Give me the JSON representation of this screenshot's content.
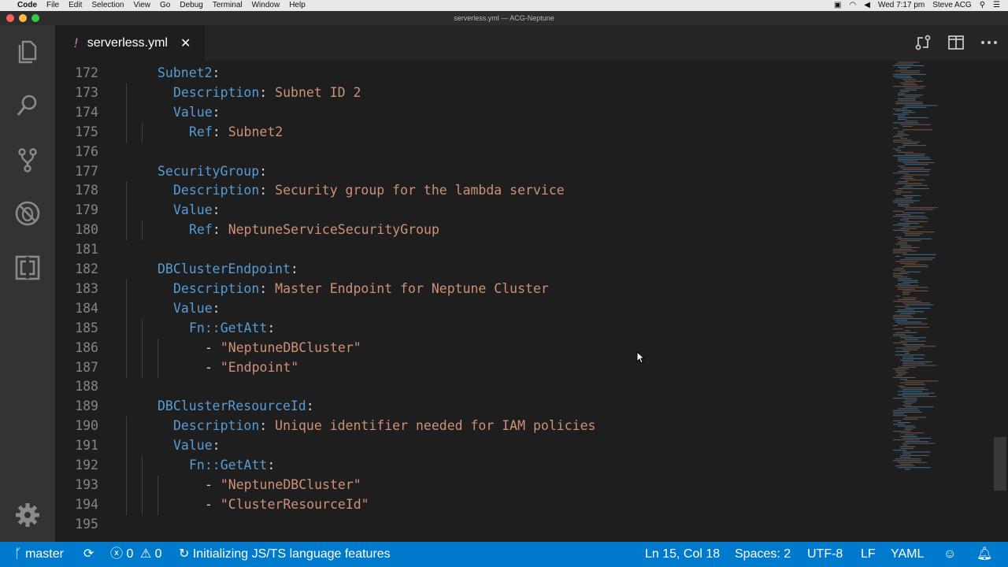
{
  "menubar": {
    "app_name": "Code",
    "items": [
      "File",
      "Edit",
      "Selection",
      "View",
      "Go",
      "Debug",
      "Terminal",
      "Window",
      "Help"
    ],
    "clock": "Wed 7:17 pm",
    "user": "Steve ACG"
  },
  "window": {
    "title": "serverless.yml — ACG-Neptune"
  },
  "activity_bar": {
    "icons": [
      "explorer-icon",
      "search-icon",
      "source-control-icon",
      "debug-icon",
      "extensions-icon",
      "gear-icon"
    ]
  },
  "tab": {
    "modified_marker": "!",
    "name": "serverless.yml",
    "close": "✕"
  },
  "editor": {
    "lines": [
      {
        "n": "172",
        "indent": 0,
        "key": "Subnet2",
        "val": ""
      },
      {
        "n": "173",
        "indent": 1,
        "key": "Description",
        "val": "Subnet ID 2"
      },
      {
        "n": "174",
        "indent": 1,
        "key": "Value",
        "val": ""
      },
      {
        "n": "175",
        "indent": 2,
        "key": "Ref",
        "val": "Subnet2"
      },
      {
        "n": "176",
        "indent": 0,
        "key": "",
        "val": ""
      },
      {
        "n": "177",
        "indent": 0,
        "key": "SecurityGroup",
        "val": ""
      },
      {
        "n": "178",
        "indent": 1,
        "key": "Description",
        "val": "Security group for the lambda service"
      },
      {
        "n": "179",
        "indent": 1,
        "key": "Value",
        "val": ""
      },
      {
        "n": "180",
        "indent": 2,
        "key": "Ref",
        "val": "NeptuneServiceSecurityGroup"
      },
      {
        "n": "181",
        "indent": 0,
        "key": "",
        "val": ""
      },
      {
        "n": "182",
        "indent": 0,
        "key": "DBClusterEndpoint",
        "val": ""
      },
      {
        "n": "183",
        "indent": 1,
        "key": "Description",
        "val": "Master Endpoint for Neptune Cluster"
      },
      {
        "n": "184",
        "indent": 1,
        "key": "Value",
        "val": ""
      },
      {
        "n": "185",
        "indent": 2,
        "key": "Fn::GetAtt",
        "val": ""
      },
      {
        "n": "186",
        "indent": 3,
        "key": "",
        "val": "\"NeptuneDBCluster\"",
        "dash": "-"
      },
      {
        "n": "187",
        "indent": 3,
        "key": "",
        "val": "\"Endpoint\"",
        "dash": "-"
      },
      {
        "n": "188",
        "indent": 0,
        "key": "",
        "val": ""
      },
      {
        "n": "189",
        "indent": 0,
        "key": "DBClusterResourceId",
        "val": ""
      },
      {
        "n": "190",
        "indent": 1,
        "key": "Description",
        "val": "Unique identifier needed for IAM policies"
      },
      {
        "n": "191",
        "indent": 1,
        "key": "Value",
        "val": ""
      },
      {
        "n": "192",
        "indent": 2,
        "key": "Fn::GetAtt",
        "val": ""
      },
      {
        "n": "193",
        "indent": 3,
        "key": "",
        "val": "\"NeptuneDBCluster\"",
        "dash": "-"
      },
      {
        "n": "194",
        "indent": 3,
        "key": "",
        "val": "\"ClusterResourceId\"",
        "dash": "-"
      },
      {
        "n": "195",
        "indent": 0,
        "key": "",
        "val": ""
      }
    ]
  },
  "statusbar": {
    "branch": "master",
    "errors": "0",
    "warnings": "0",
    "task": "Initializing JS/TS language features",
    "cursor": "Ln 15, Col 18",
    "spaces": "Spaces: 2",
    "encoding": "UTF-8",
    "eol": "LF",
    "language": "YAML"
  },
  "colors": {
    "accent": "#007acc",
    "keyword": "#569cd6",
    "string": "#ce9178",
    "modified": "#c586c0"
  }
}
